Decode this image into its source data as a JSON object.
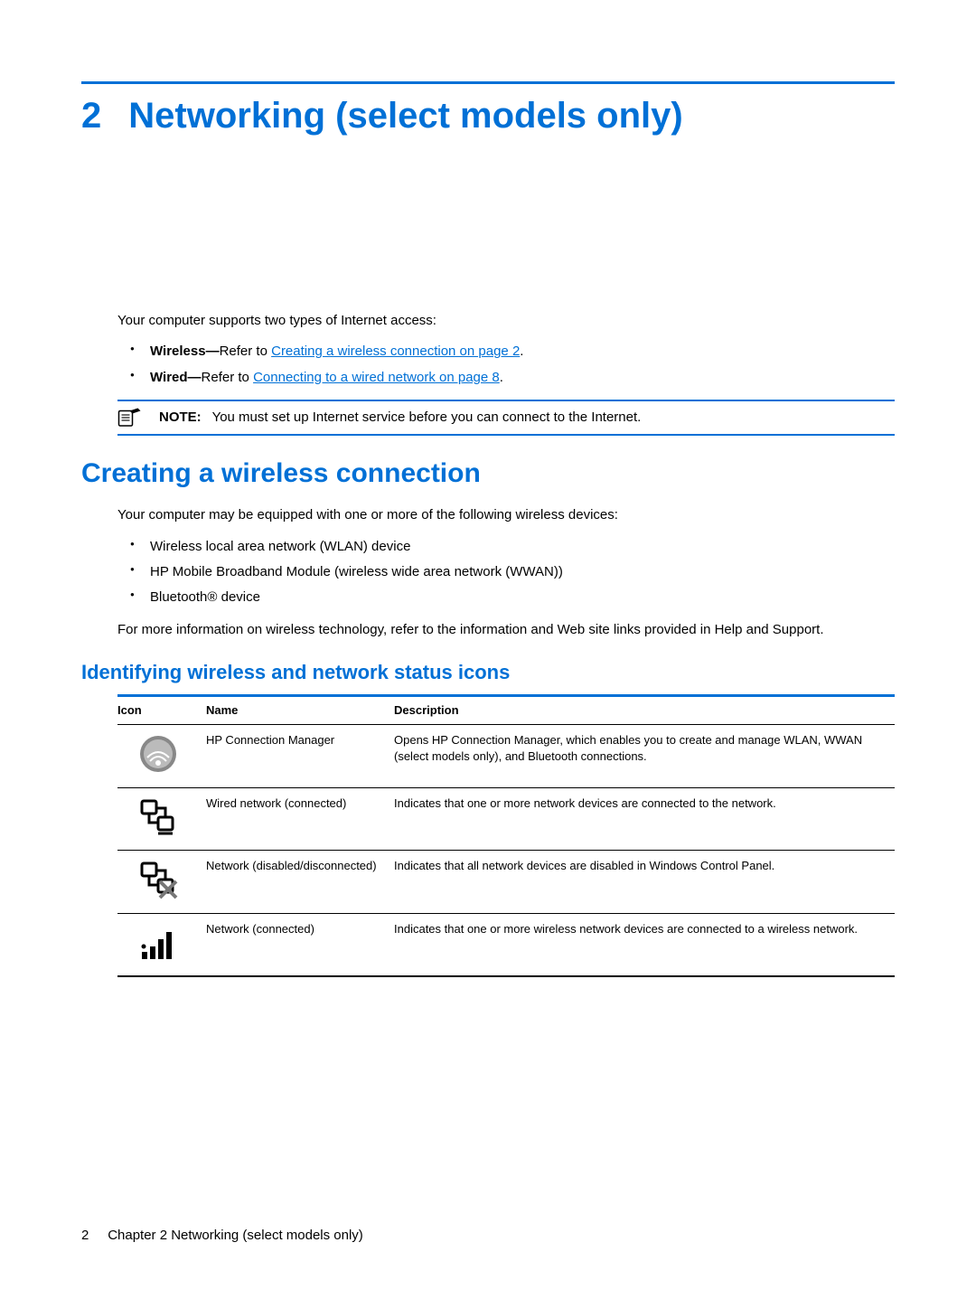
{
  "chapter": {
    "number": "2",
    "title": "Networking (select models only)"
  },
  "intro": "Your computer supports two types of Internet access:",
  "access_list": [
    {
      "prefix": "Wireless—",
      "text": "Refer to ",
      "link": "Creating a wireless connection on page 2",
      "suffix": "."
    },
    {
      "prefix": "Wired—",
      "text": "Refer to ",
      "link": "Connecting to a wired network on page 8",
      "suffix": "."
    }
  ],
  "note": {
    "label": "NOTE:",
    "text": "You must set up Internet service before you can connect to the Internet."
  },
  "section1": {
    "title": "Creating a wireless connection",
    "intro": "Your computer may be equipped with one or more of the following wireless devices:",
    "devices": [
      "Wireless local area network (WLAN) device",
      "HP Mobile Broadband Module (wireless wide area network (WWAN))",
      "Bluetooth® device"
    ],
    "outro": "For more information on wireless technology, refer to the information and Web site links provided in Help and Support."
  },
  "subsection1": {
    "title": "Identifying wireless and network status icons",
    "columns": {
      "c1": "Icon",
      "c2": "Name",
      "c3": "Description"
    },
    "rows": [
      {
        "name": "HP Connection Manager",
        "desc": "Opens HP Connection Manager, which enables you to create and manage WLAN, WWAN (select models only), and Bluetooth connections."
      },
      {
        "name": "Wired network (connected)",
        "desc": "Indicates that one or more network devices are connected to the network."
      },
      {
        "name": "Network (disabled/disconnected)",
        "desc": "Indicates that all network devices are disabled in Windows Control Panel."
      },
      {
        "name": "Network (connected)",
        "desc": "Indicates that one or more wireless network devices are connected to a wireless network."
      }
    ]
  },
  "footer": {
    "page": "2",
    "chapter_label": "Chapter 2   Networking (select models only)"
  }
}
